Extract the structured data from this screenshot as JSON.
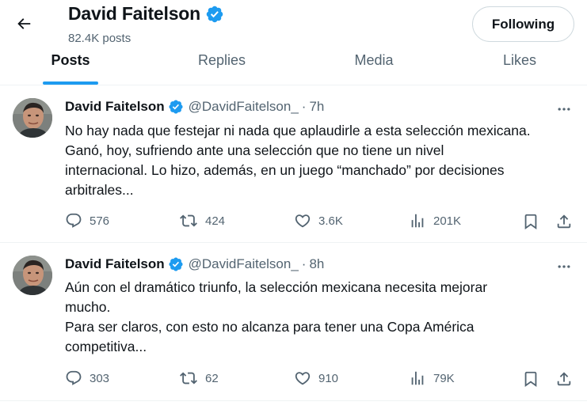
{
  "header": {
    "name": "David Faitelson",
    "post_count": "82.4K posts",
    "following_label": "Following"
  },
  "tabs": [
    {
      "label": "Posts",
      "active": true
    },
    {
      "label": "Replies",
      "active": false
    },
    {
      "label": "Media",
      "active": false
    },
    {
      "label": "Likes",
      "active": false
    }
  ],
  "tweets": [
    {
      "author": "David Faitelson",
      "handle": "@DavidFaitelson_",
      "dot": "·",
      "time": "7h",
      "text": "No hay nada que festejar ni nada que aplaudirle a esta selección mexicana.\nGanó, hoy, sufriendo ante una selección que no tiene un nivel\ninternacional. Lo hizo, además, en un juego “manchado” por decisiones\narbitrales...",
      "replies": "576",
      "reposts": "424",
      "likes": "3.6K",
      "views": "201K"
    },
    {
      "author": "David Faitelson",
      "handle": "@DavidFaitelson_",
      "dot": "·",
      "time": "8h",
      "text": "Aún con el dramático triunfo, la selección mexicana necesita mejorar\nmucho.\nPara ser claros, con esto no alcanza para tener una Copa América\ncompetitiva...",
      "replies": "303",
      "reposts": "62",
      "likes": "910",
      "views": "79K"
    }
  ],
  "icons": {
    "back": "arrow-left-icon",
    "verified": "verified-badge-icon",
    "more": "more-horizontal-icon",
    "reply": "reply-icon",
    "repost": "repost-icon",
    "like": "heart-icon",
    "views": "views-icon",
    "bookmark": "bookmark-icon",
    "share": "share-icon"
  },
  "colors": {
    "accent": "#1d9bf0",
    "text": "#0f1419",
    "secondary": "#536471",
    "border": "#eff3f4"
  }
}
